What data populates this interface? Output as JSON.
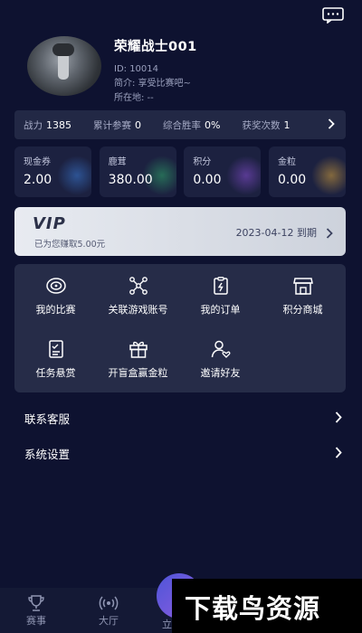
{
  "profile": {
    "username": "荣耀战士001",
    "id_text": "ID: 10014",
    "intro_text": "简介: 享受比赛吧~",
    "location_text": "所在地: --"
  },
  "stats": [
    {
      "label": "战力",
      "value": "1385"
    },
    {
      "label": "累计参赛",
      "value": "0"
    },
    {
      "label": "综合胜率",
      "value": "0%"
    },
    {
      "label": "获奖次数",
      "value": "1"
    }
  ],
  "wallet": [
    {
      "label": "现金券",
      "value": "2.00",
      "color": "#3b7bd6"
    },
    {
      "label": "鹿茸",
      "value": "380.00",
      "color": "#2fa86a"
    },
    {
      "label": "积分",
      "value": "0.00",
      "color": "#8a4fd6"
    },
    {
      "label": "金粒",
      "value": "0.00",
      "color": "#d6a23b"
    }
  ],
  "vip": {
    "title": "VIP",
    "subtitle": "已为您赚取5.00元",
    "expiry": "2023-04-12 到期"
  },
  "grid": [
    {
      "label": "我的比赛",
      "icon": "target-icon"
    },
    {
      "label": "关联游戏账号",
      "icon": "network-icon"
    },
    {
      "label": "我的订单",
      "icon": "clipboard-icon"
    },
    {
      "label": "积分商城",
      "icon": "store-icon"
    },
    {
      "label": "任务悬赏",
      "icon": "checklist-icon"
    },
    {
      "label": "开盲盒赢金粒",
      "icon": "gift-icon"
    },
    {
      "label": "邀请好友",
      "icon": "user-heart-icon"
    }
  ],
  "list": [
    {
      "label": "联系客服"
    },
    {
      "label": "系统设置"
    }
  ],
  "tabs": [
    {
      "label": "赛事",
      "icon": "trophy-icon"
    },
    {
      "label": "大厅",
      "icon": "broadcast-icon"
    },
    {
      "label": "立即",
      "icon": "play-icon"
    }
  ],
  "watermark": "下载鸟资源",
  "colors": {
    "background": "#0e1230",
    "card": "#262c48",
    "accent": "#6b5de0"
  }
}
